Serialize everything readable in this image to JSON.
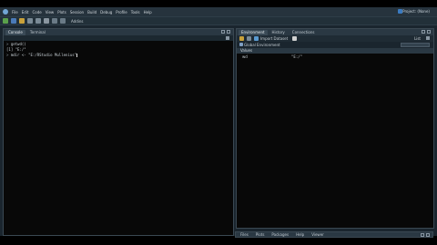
{
  "menubar": {
    "items": [
      "File",
      "Edit",
      "Code",
      "View",
      "Plots",
      "Session",
      "Build",
      "Debug",
      "Profile",
      "Tools",
      "Help"
    ],
    "project_label": "Project: (None)"
  },
  "toolbar": {
    "addins_label": "Addins"
  },
  "left_pane": {
    "tabs": [
      "Console",
      "Terminal"
    ],
    "console_lines": [
      {
        "prompt": ">",
        "text": " getwd()"
      },
      {
        "prompt": "",
        "text": "[1] \"E:/\""
      },
      {
        "prompt": ">",
        "text": " mdir <- \"E:/RStudio Mullenius\""
      }
    ]
  },
  "right_top_pane": {
    "tabs": [
      "Environment",
      "History",
      "Connections"
    ],
    "import_dataset_label": "Import Dataset",
    "list_label": "List",
    "env_selector_label": "Global Environment",
    "section_header": "Values",
    "variables": [
      {
        "name": "wd",
        "value": "\"E:/\""
      }
    ]
  },
  "right_bottom_pane": {
    "tabs": [
      "Files",
      "Plots",
      "Packages",
      "Help",
      "Viewer"
    ]
  },
  "colors": {
    "ide_bg": "#1a252e",
    "console_bg": "#080808",
    "tab_active": "#3a4a56",
    "accent": "#72a6d5"
  }
}
